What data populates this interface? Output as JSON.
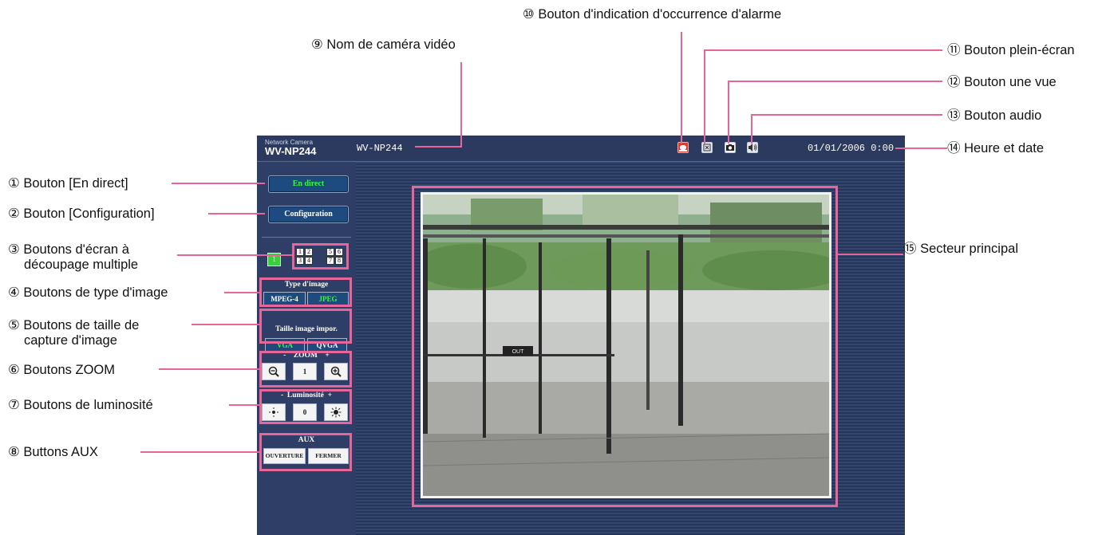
{
  "camera_ui": {
    "brand_small": "Network Camera",
    "brand_model": "WV-NP244",
    "camera_name": "WV-NP244",
    "datetime": "01/01/2006  0:00",
    "buttons": {
      "live": "En direct",
      "setup": "Configuration",
      "split1": "1",
      "split4": [
        "1",
        "2",
        "3",
        "4"
      ],
      "split9": [
        "5",
        "6",
        "7",
        "8"
      ]
    },
    "image_type": {
      "title": "Type d'image",
      "options": [
        "MPEG-4",
        "JPEG"
      ],
      "selected": "JPEG"
    },
    "capture_size": {
      "title": "Taille image impor.",
      "options": [
        "VGA",
        "QVGA"
      ],
      "selected": "VGA"
    },
    "zoom": {
      "title": "-    ZOOM    +",
      "value": "1"
    },
    "brightness": {
      "title": "-  Luminosité  +",
      "value": "0"
    },
    "aux": {
      "title": "AUX",
      "open": "OUVERTURE",
      "close": "FERMER"
    },
    "scene_sign": "OUT"
  },
  "callouts": {
    "c1": "① Bouton [En direct]",
    "c2": "② Bouton [Configuration]",
    "c3a": "③ Boutons d'écran à",
    "c3b": "découpage multiple",
    "c4": "④ Boutons de type d'image",
    "c5a": "⑤ Boutons de taille de",
    "c5b": "capture d'image",
    "c6": "⑥ Boutons ZOOM",
    "c7": "⑦ Boutons de luminosité",
    "c8": "⑧ Buttons AUX",
    "c9": "⑨ Nom de caméra vidéo",
    "c10": "⑩ Bouton d'indication d'occurrence d'alarme",
    "c11": "⑪ Bouton plein-écran",
    "c12": "⑫ Bouton une vue",
    "c13": "⑬ Bouton audio",
    "c14": "⑭ Heure et date",
    "c15": "⑮ Secteur principal"
  },
  "colors": {
    "callout_pink": "#e8659a",
    "ui_background": "#2b3a5e",
    "active_green": "#33ff33",
    "button_blue": "#1e4b7f"
  },
  "icons": [
    "alarm-icon",
    "fullscreen-icon",
    "snapshot-icon",
    "audio-icon",
    "zoom-out-icon",
    "zoom-in-icon",
    "brightness-down-icon",
    "brightness-up-icon"
  ]
}
